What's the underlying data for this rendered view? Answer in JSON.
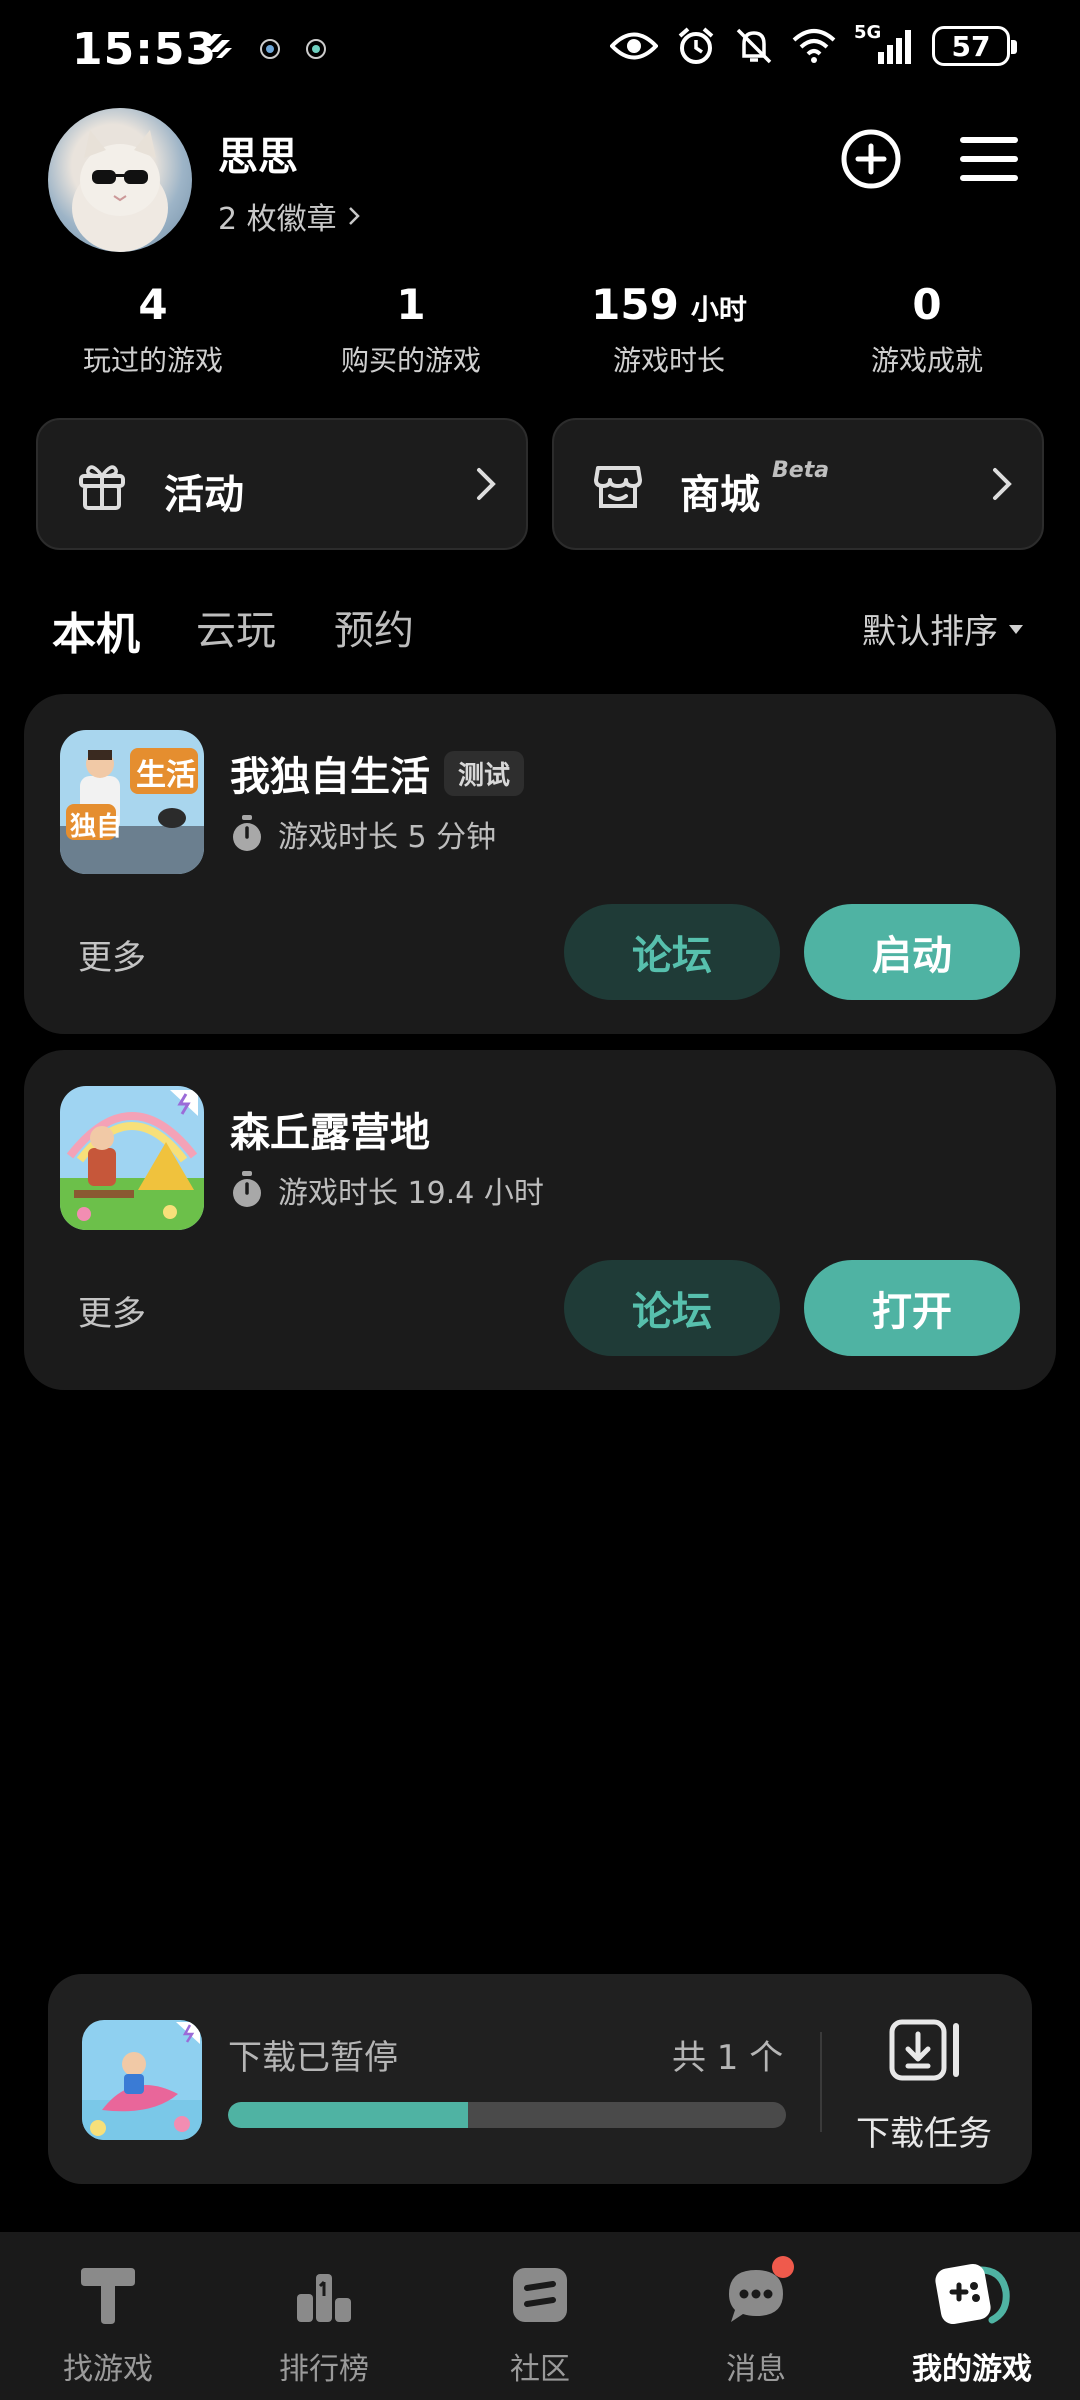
{
  "status_bar": {
    "time": "15:53",
    "battery": "57",
    "network": "5G"
  },
  "profile": {
    "name": "思思",
    "badges": "2 枚徽章"
  },
  "stats": [
    {
      "value": "4",
      "unit": "",
      "label": "玩过的游戏"
    },
    {
      "value": "1",
      "unit": "",
      "label": "购买的游戏"
    },
    {
      "value": "159",
      "unit": "小时",
      "label": "游戏时长"
    },
    {
      "value": "0",
      "unit": "",
      "label": "游戏成就"
    }
  ],
  "shortcuts": {
    "activity": "活动",
    "store": "商城",
    "store_badge": "Beta"
  },
  "tabs": {
    "local": "本机",
    "cloud": "云玩",
    "reserve": "预约",
    "sort": "默认排序"
  },
  "games": [
    {
      "name": "我独自生活",
      "tag": "测试",
      "playtime": "游戏时长 5 分钟",
      "more": "更多",
      "forum": "论坛",
      "action": "启动"
    },
    {
      "name": "森丘露营地",
      "tag": "",
      "playtime": "游戏时长 19.4 小时",
      "more": "更多",
      "forum": "论坛",
      "action": "打开"
    }
  ],
  "download": {
    "status": "下载已暂停",
    "count": "共 1 个",
    "progress": 0.43,
    "task_label": "下载任务"
  },
  "nav": [
    {
      "label": "找游戏"
    },
    {
      "label": "排行榜"
    },
    {
      "label": "社区"
    },
    {
      "label": "消息"
    },
    {
      "label": "我的游戏"
    }
  ],
  "colors": {
    "accent": "#4fb3a3",
    "forum_bg": "#1f3b37",
    "card_bg": "#1b1b1b",
    "notify_dot": "#ef5a4c"
  }
}
